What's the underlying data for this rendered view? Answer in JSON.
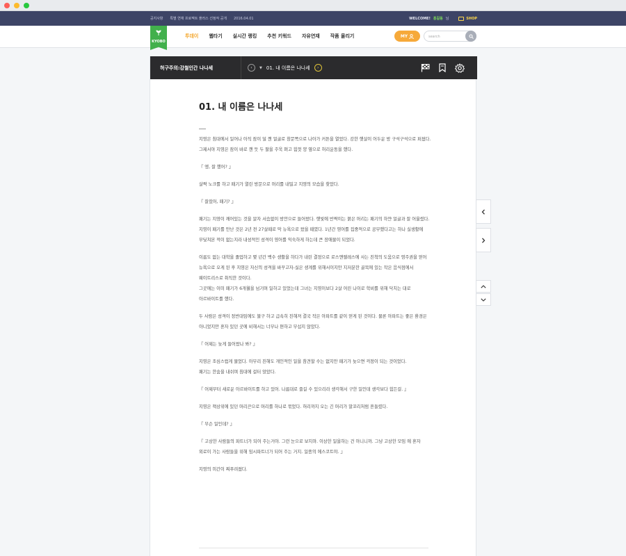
{
  "notice": {
    "item1": "공지사항",
    "item2": "특별 연재 프로젝트 플러스 선정작 공개",
    "date": "2016.04.01",
    "welcome": "WELCOME!",
    "user": "홍길동",
    "user_suffix": "님",
    "shop": "SHOP"
  },
  "header": {
    "logo": "KYOBO",
    "nav": [
      "투데이",
      "웹타기",
      "실시간 랭킹",
      "추천 키워드",
      "자유연재",
      "작품 올리기"
    ],
    "my_label": "MY",
    "search_placeholder": "search"
  },
  "reader": {
    "work_title": "허구주의:강철인간 나나세",
    "episode_label": "01. 내 이름은 나나세",
    "episode_title": "01. 내 이름은 나나세",
    "paragraphs": [
      "지영은 침대에서 일어나 아직 잠이 덜 깬 얼굴로 창문쪽으로 나아가 커튼을 열었다. 강한 햇살이 어두운 방 구석구석으로 퍼졌다. 그제서야 지영은 잠이 바로 깬 듯 두 팔을 주욱 펴고 힘껏 양 옆으로 허리운동을 했다.",
      "『 엥, 잘 했어? 』",
      "살짝 노크를 하고 패기가 열린 방문으로 머리를 내밀고 지영의 모습을 찾았다.",
      "『 잘잤어, 패기? 』",
      "패기는 지영이 깨어있는 것을 알자 서슴없이 방안으로 들어왔다. 햇빛에 반짝이는 붉은 머리는 패기의 하얀 얼굴과 잘 어울렸다.\n지영이 패기를 만난 것은 2년 전 27살때로 막 뉴욕으로 왔을 때였다. 1년간 영어를 집중적으로 공부했다고는 하나 실생활에 부딪쳐본 적이 없는지라 내성적인 성격이 영어를 익숙하게 하는데 큰 장애물이 되었다.",
      "이름도 없는 대학을 졸업하고 몇 년간 백수 생활을 하다가 내린 결정으로 로스앤젤레스에 사는 친척의 도움으로 영주권을 얻어 뉴욕으로 오게 된 후 지영은 자신의 성격을 바꾸고자-실은 생계를 위해서이지만 지저분한 골목에 있는 작은 음식점에서 웨이트리스로 취직한 것이다.\n그곳에는 이미 패기가 6개월을 넘기며 일하고 있었는데 그녀는 지영이보다 2살 어린 나이로 학비를 위해 닥치는 대로 아르바이트를 했다.",
      "두 사람은 성격이 정반대임에도 불구 하고 급속히 친해져 결국 작은 아파트를 같이 얻게 된 것이다. 물론 아파트는 좋은 환경은 아니었지만 혼자 있던 곳에 비해서는 너무나 편하고 무섭지 않았다.",
      "『 어제는 늦게 들어왔나 봐? 』",
      "지영은 조심스럽게 물었다. 아무리 친해도 개인적인 일을 참견할 수는 없지만 패기가 늦으면 걱정이 되는 것이었다.\n패기는 한숨을 내쉬며 침대에 걸터 앉았다.",
      "『 어제부터 새로운 아르바이트를 하고 있어. 나름대로 즐길 수 있으리라 생각해서 구한 일인데 생각보다 힘든걸. 』",
      "지영은 책상위에 있던 머리끈으로 머리를 하나로 묶었다. 허리까지 오는 긴 머리가 말꼬리처럼 흔들렸다.",
      "『 무슨 일인데? 』",
      "『 고상한 사람들의 파트너가 되어 주는거야. 그런 눈으로 보지마. 이상한 일을하는 건 아니니까. 그냥 고상한 모임 에 혼자 외로이 가는 사람들을 위해 임시파트너가 되어 주는 거지. 일종의 에스코트야. 』",
      "지영의 미간이 찌푸려졌다."
    ]
  },
  "colors": {
    "notice_bg": "#3d4466",
    "logo_green": "#42b04c",
    "accent_orange": "#f4a52a",
    "reader_bar": "#2b2b2d"
  }
}
